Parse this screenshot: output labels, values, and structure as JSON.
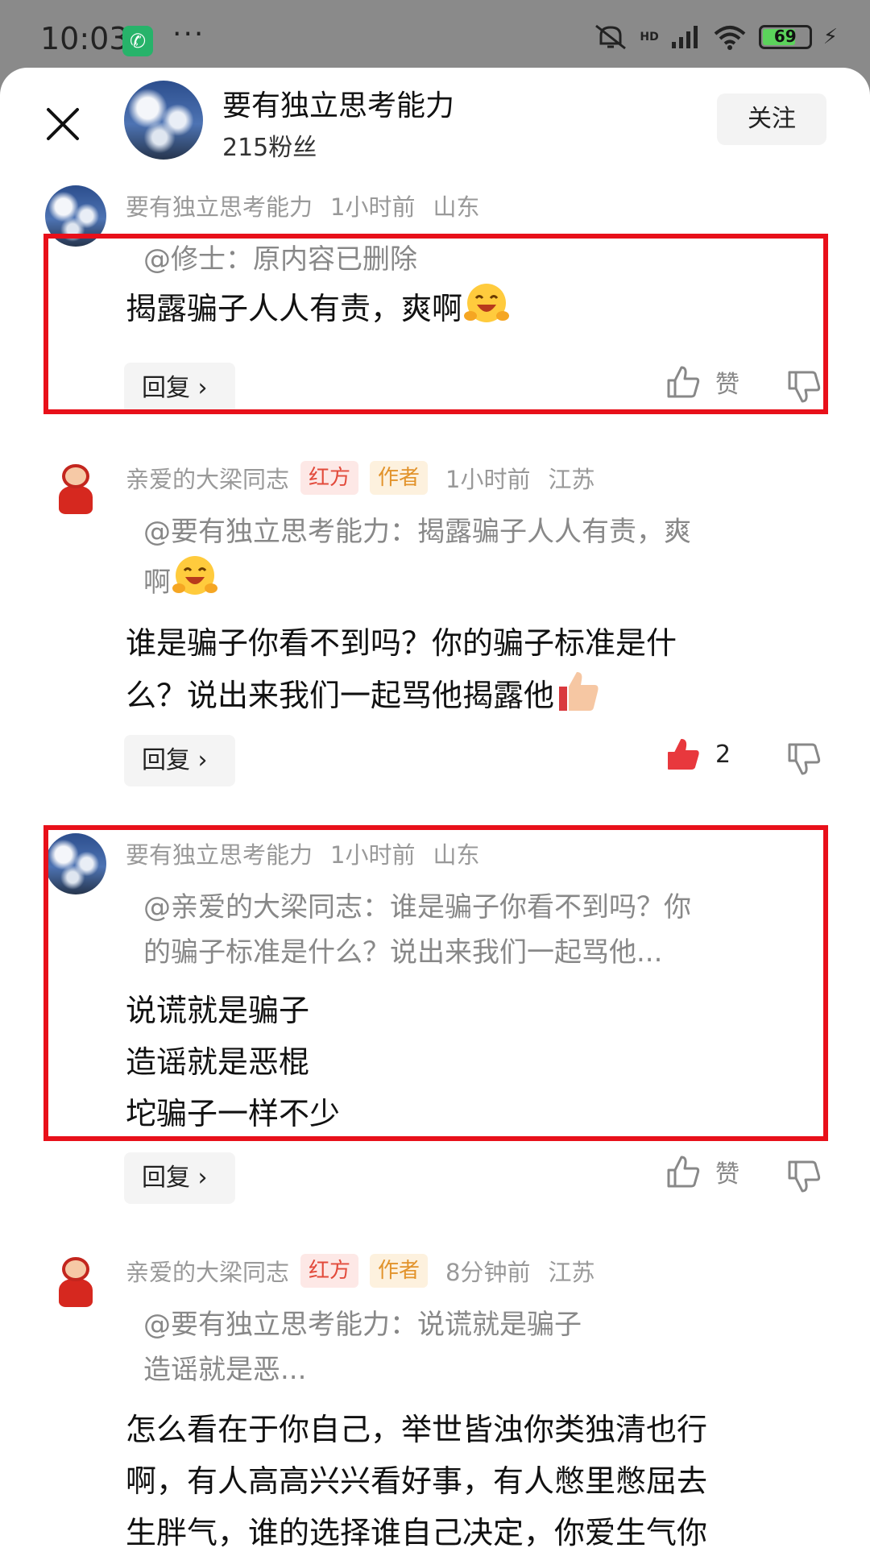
{
  "status_bar": {
    "time": "10:03",
    "call_icon": "phone-icon",
    "more": "···",
    "network": "HD",
    "battery": "69"
  },
  "header": {
    "user_name": "要有独立思考能力",
    "fans": "215粉丝",
    "follow_label": "关注"
  },
  "comments": [
    {
      "author": "要有独立思考能力",
      "time": "1小时前",
      "location": "山东",
      "quote": "@修士：原内容已删除",
      "body": "揭露骗子人人有责，爽啊",
      "reply_label": "回复 ›",
      "like_label": "赞"
    },
    {
      "author": "亲爱的大梁同志",
      "tag_red": "红方",
      "tag_author": "作者",
      "time": "1小时前",
      "location": "江苏",
      "quote_line1": "@要有独立思考能力：揭露骗子人人有责，爽",
      "quote_line2": "啊",
      "body_line1": "谁是骗子你看不到吗？你的骗子标准是什",
      "body_line2": "么？说出来我们一起骂他揭露他",
      "reply_label": "回复 ›",
      "like_count": "2"
    },
    {
      "author": "要有独立思考能力",
      "time": "1小时前",
      "location": "山东",
      "quote_line1": "@亲爱的大梁同志：谁是骗子你看不到吗？你",
      "quote_line2": "的骗子标准是什么？说出来我们一起骂他...",
      "body_line1": "说谎就是骗子",
      "body_line2": "造谣就是恶棍",
      "body_line3": "坨骗子一样不少",
      "reply_label": "回复 ›",
      "like_label": "赞"
    },
    {
      "author": "亲爱的大梁同志",
      "tag_red": "红方",
      "tag_author": "作者",
      "time": "8分钟前",
      "location": "江苏",
      "quote_line1": "@要有独立思考能力：说谎就是骗子",
      "quote_line2": "造谣就是恶...",
      "body_line1": "怎么看在于你自己，举世皆浊你类独清也行",
      "body_line2": "啊，有人高高兴兴看好事，有人憋里憋屈去",
      "body_line3": "生胖气，谁的选择谁自己决定，你爱生气你"
    }
  ],
  "colors": {
    "highlight": "#e8101a",
    "like_active": "#e8383d",
    "tag_red": "#e24a3b",
    "tag_author": "#e2932b"
  }
}
